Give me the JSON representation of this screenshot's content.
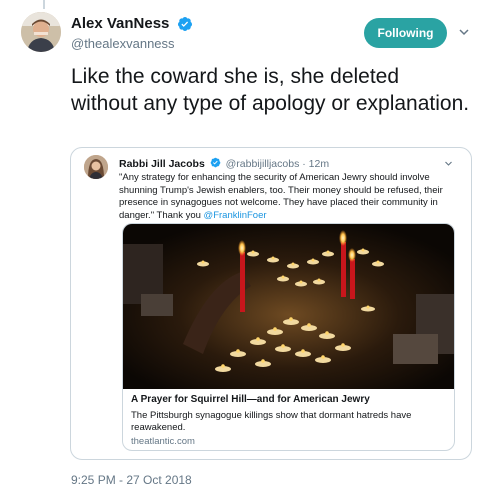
{
  "tweet": {
    "author": {
      "display_name": "Alex VanNess",
      "handle": "@thealexvanness",
      "verified": true
    },
    "follow_button_label": "Following",
    "text": "Like the coward she is, she deleted without any type of apology or explanation.",
    "timestamp": "9:25 PM - 27 Oct 2018"
  },
  "quoted_tweet": {
    "author": {
      "display_name": "Rabbi Jill Jacobs",
      "handle": "@rabbijilljacobs",
      "separator": "·",
      "time": "12m",
      "verified": true
    },
    "text_main": "\"Any strategy for enhancing the security of American Jewry should involve shunning Trump's Jewish enablers, too. Their money should be refused, their presence in synagogues not welcome. They have placed their community in danger.\" Thank you ",
    "mention": "@FranklinFoer",
    "card": {
      "title": "A Prayer for Squirrel Hill—and for American Jewry",
      "description": "The Pittsburgh synagogue killings show that dormant hatreds have reawakened.",
      "domain": "theatlantic.com",
      "image_subject": "memorial-candles"
    }
  },
  "colors": {
    "follow_button": "#2aa3a3",
    "verified_badge": "#1da1f2",
    "link": "#1b95e0",
    "secondary_text": "#657786",
    "border": "#ccd6dd"
  },
  "icons": [
    "verified-badge-icon",
    "chevron-down-icon"
  ]
}
